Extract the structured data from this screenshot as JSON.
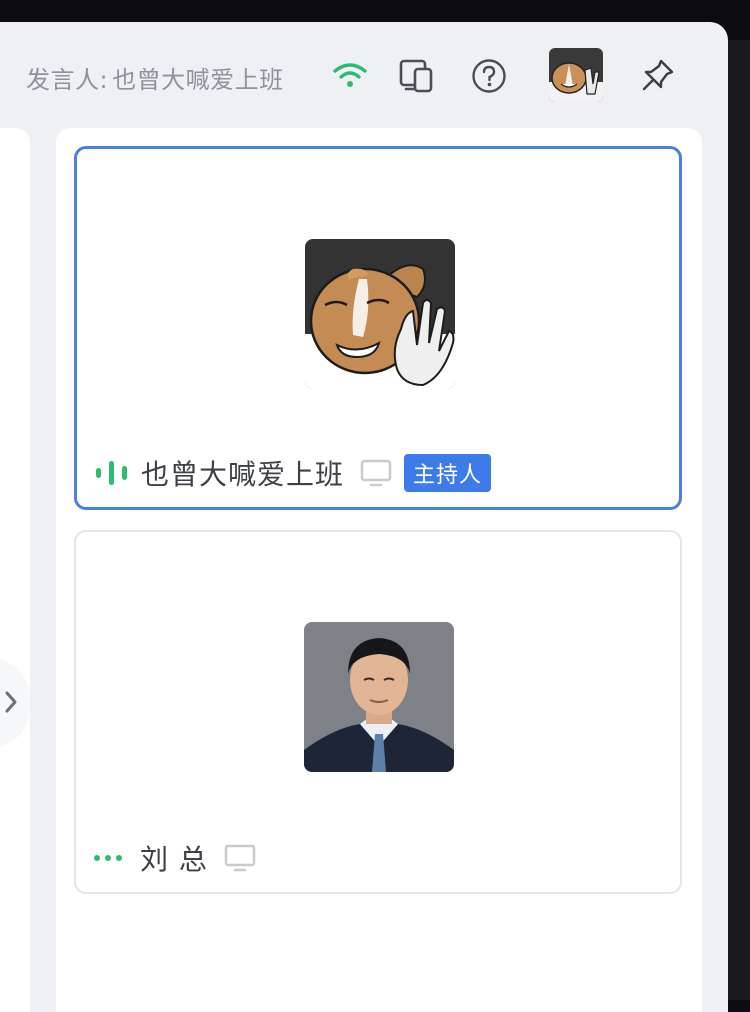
{
  "topbar": {
    "speaker_label": "发言人:",
    "speaker_name": "也曾大喊爱上班",
    "icons": [
      "wifi-icon",
      "device-switch-icon",
      "help-icon",
      "user-avatar",
      "pin-icon"
    ]
  },
  "participants": [
    {
      "name": "也曾大喊爱上班",
      "badge": "主持人",
      "status": "speaking",
      "active": true
    },
    {
      "name": "刘 总",
      "badge": "",
      "status": "muted-idle",
      "active": false
    }
  ],
  "colors": {
    "accent": "#3c7be8",
    "active_border": "#4f7fdc",
    "speaking_green": "#2dbb6e",
    "background": "#eef0f4"
  }
}
